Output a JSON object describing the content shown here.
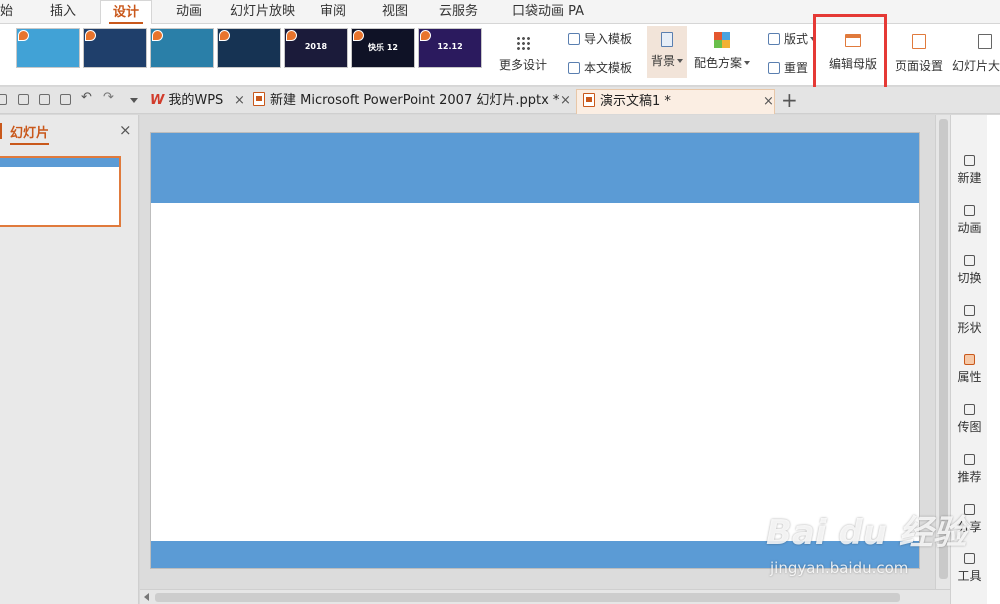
{
  "menu": {
    "items": [
      "始",
      "插入",
      "设计",
      "动画",
      "幻灯片放映",
      "审阅",
      "视图",
      "云服务",
      "口袋动画 PA"
    ],
    "active_index": 2
  },
  "ribbon": {
    "templates": [
      {
        "label": "",
        "color": "#41a2d6"
      },
      {
        "label": "",
        "color": "#1f3f6b"
      },
      {
        "label": "",
        "color": "#2a7fa8"
      },
      {
        "label": "",
        "color": "#163353"
      },
      {
        "label": "2018",
        "color": "#1b1b3a"
      },
      {
        "label": "快乐 12",
        "color": "#0f1226"
      },
      {
        "label": "12.12",
        "color": "#2b1a5e"
      }
    ],
    "more_design": "更多设计",
    "import_template": "导入模板",
    "text_template": "本文模板",
    "background": "背景",
    "color_scheme": "配色方案",
    "layout": "版式",
    "reset": "重置",
    "edit_master": "编辑母版",
    "page_setup": "页面设置",
    "slide_size": "幻灯片大"
  },
  "tabs": {
    "items": [
      {
        "label": "我的WPS",
        "icon": "wps-logo-icon"
      },
      {
        "label": "新建 Microsoft PowerPoint 2007 幻灯片.pptx *",
        "icon": "ppt-file-icon"
      },
      {
        "label": "演示文稿1 *",
        "icon": "ppt-file-icon"
      }
    ],
    "active_index": 2
  },
  "left_panel": {
    "title": "幻灯片"
  },
  "right_sidebar": {
    "items": [
      "新建",
      "动画",
      "切换",
      "形状",
      "属性",
      "传图",
      "推荐",
      "分享",
      "工具"
    ],
    "active_index": 4
  },
  "watermark": {
    "logo": "Bai du 经验",
    "url": "jingyan.baidu.com"
  },
  "colors": {
    "accent": "#c9581b",
    "slide_band": "#5b9bd5",
    "highlight": "#e53935"
  }
}
